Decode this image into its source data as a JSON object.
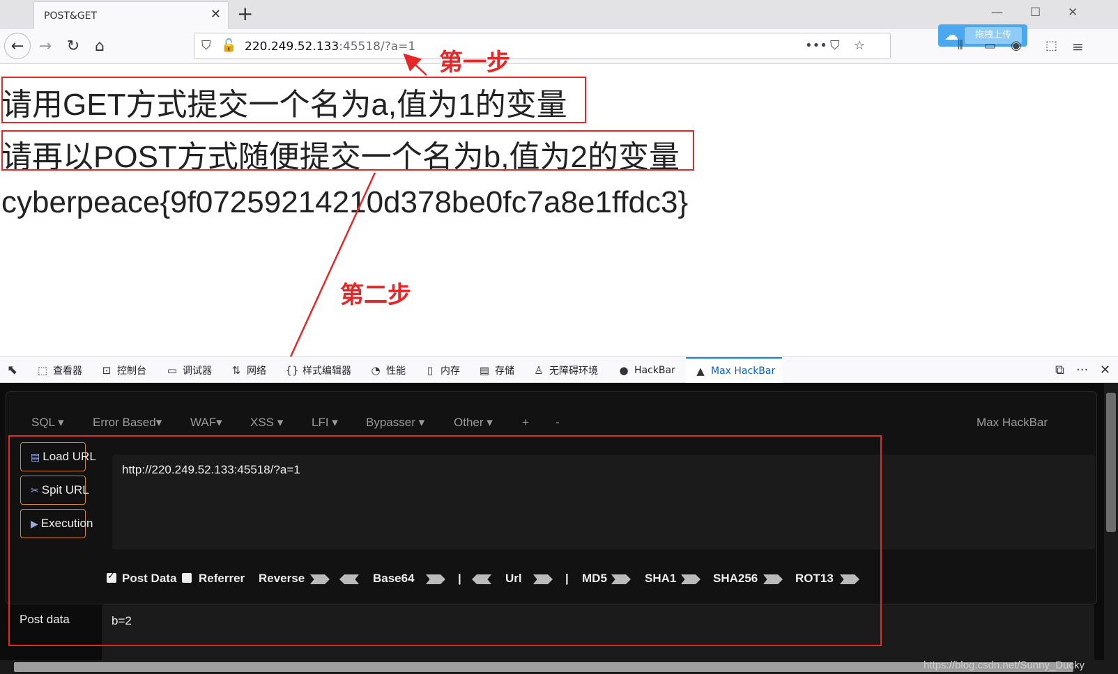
{
  "browser": {
    "tab_title": "POST&GET",
    "tab_close": "✕",
    "new_tab": "+",
    "url_host": "220.249.52.133",
    "url_rest": ":45518/?a=1",
    "ext_upload_label": "拖拽上传"
  },
  "page": {
    "line1": "请用GET方式提交一个名为a,值为1的变量",
    "line2": "请再以POST方式随便提交一个名为b,值为2的变量",
    "flag": "cyberpeace{9f07259214210d378be0fc7a8e1ffdc3}"
  },
  "annotations": {
    "step1": "第一步",
    "step2": "第二步",
    "color": "#e52727"
  },
  "devtools": {
    "tabs": [
      {
        "label": "查看器",
        "icon": "inspector-icon"
      },
      {
        "label": "控制台",
        "icon": "console-icon"
      },
      {
        "label": "调试器",
        "icon": "debugger-icon"
      },
      {
        "label": "网络",
        "icon": "network-icon"
      },
      {
        "label": "样式编辑器",
        "icon": "style-editor-icon"
      },
      {
        "label": "性能",
        "icon": "performance-icon"
      },
      {
        "label": "内存",
        "icon": "memory-icon"
      },
      {
        "label": "存储",
        "icon": "storage-icon"
      },
      {
        "label": "无障碍环境",
        "icon": "accessibility-icon"
      },
      {
        "label": "HackBar",
        "icon": "hackbar-icon"
      },
      {
        "label": "Max HackBar",
        "icon": "max-hackbar-icon",
        "active": true
      }
    ]
  },
  "hackbar": {
    "menus": [
      "SQL ▾",
      "Error Based▾",
      "WAF▾",
      "XSS ▾",
      "LFI ▾",
      "Bypasser ▾",
      "Other ▾",
      "+",
      "-"
    ],
    "title": "Max HackBar",
    "load_url": "Load URL",
    "split_url": "Spit URL",
    "execution": "Execution",
    "url_value": "http://220.249.52.133:45518/?a=1",
    "post_data_check": "Post Data",
    "referrer_check": "Referrer",
    "post_data_checked": true,
    "referrer_checked": false,
    "reverse": "Reverse",
    "base64": "Base64",
    "sep": "|",
    "url": "Url",
    "md5": "MD5",
    "sha1": "SHA1",
    "sha256": "SHA256",
    "rot13": "ROT13",
    "post_label": "Post data",
    "post_value": "b=2"
  },
  "watermark": "https://blog.csdn.net/Sunny_Ducky"
}
